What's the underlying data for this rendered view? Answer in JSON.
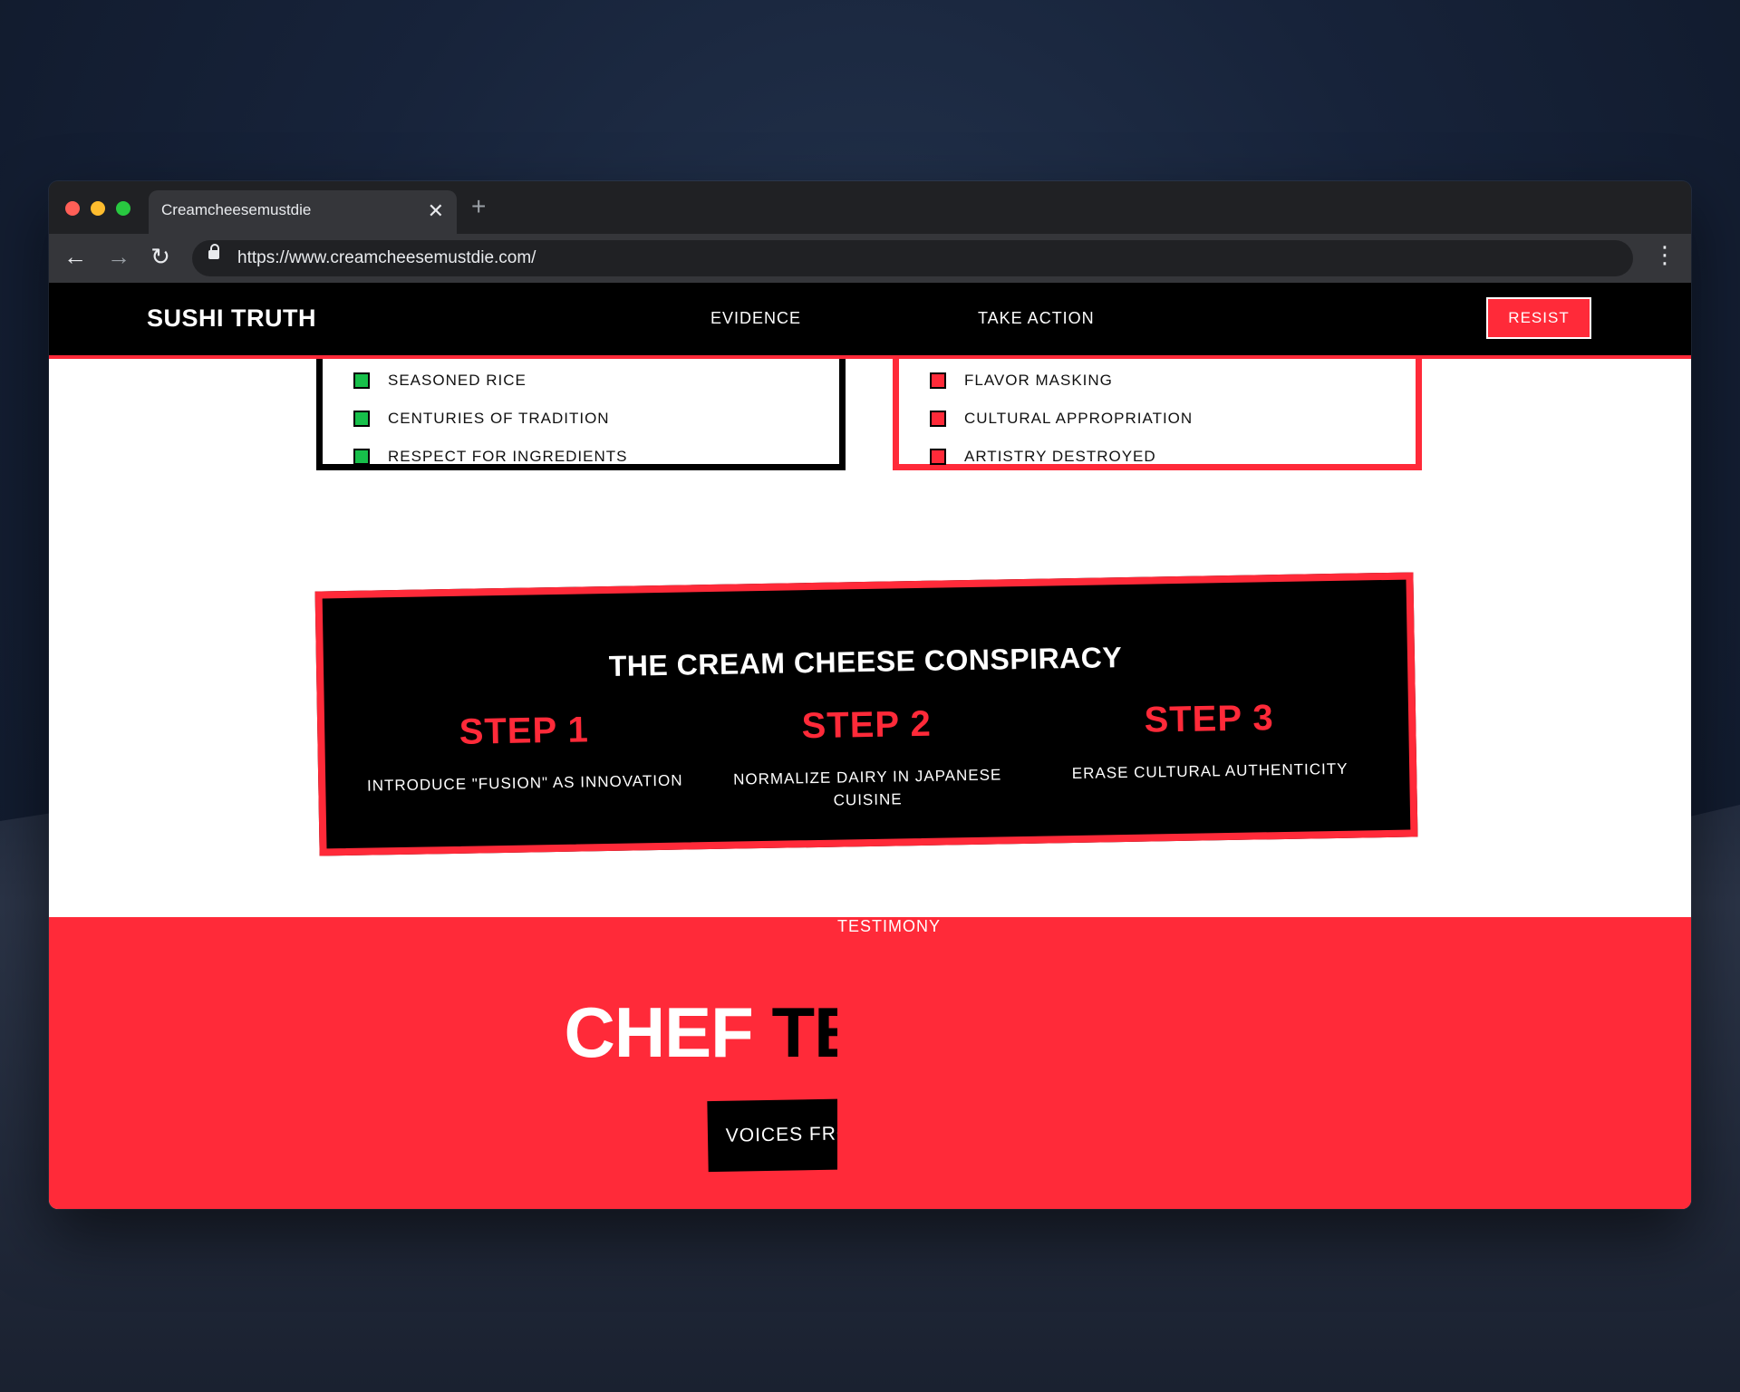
{
  "browser": {
    "tab_title": "Creamcheesemustdie",
    "close_glyph": "✕",
    "new_tab_glyph": "+",
    "back_glyph": "←",
    "forward_glyph": "→",
    "reload_glyph": "↻",
    "url": "https://www.creamcheesemustdie.com/",
    "menu_glyph": "⋮"
  },
  "nav": {
    "brand": "SUSHI TRUTH",
    "links": [
      "EVIDENCE",
      "TESTIMONY",
      "TAKE ACTION"
    ],
    "cta": "RESIST"
  },
  "comparison": {
    "good_items": [
      "SEASONED RICE",
      "CENTURIES OF TRADITION",
      "RESPECT FOR INGREDIENTS"
    ],
    "bad_items": [
      "FLAVOR MASKING",
      "CULTURAL APPROPRIATION",
      "ARTISTRY DESTROYED"
    ]
  },
  "conspiracy": {
    "title": "THE CREAM CHEESE CONSPIRACY",
    "steps": [
      {
        "label": "STEP 1",
        "text": "INTRODUCE \"FUSION\" AS INNOVATION"
      },
      {
        "label": "STEP 2",
        "text": "NORMALIZE DAIRY IN JAPANESE CUISINE"
      },
      {
        "label": "STEP 3",
        "text": "ERASE CULTURAL AUTHENTICITY"
      }
    ]
  },
  "testimony": {
    "heading_first": "CHEF",
    "heading_second": "TESTIMONY",
    "subtitle": "VOICES FROM THE KITCHEN"
  },
  "colors": {
    "accent_red": "#ff2a39",
    "bullet_green": "#17c04a",
    "nav_bg": "#000000"
  }
}
